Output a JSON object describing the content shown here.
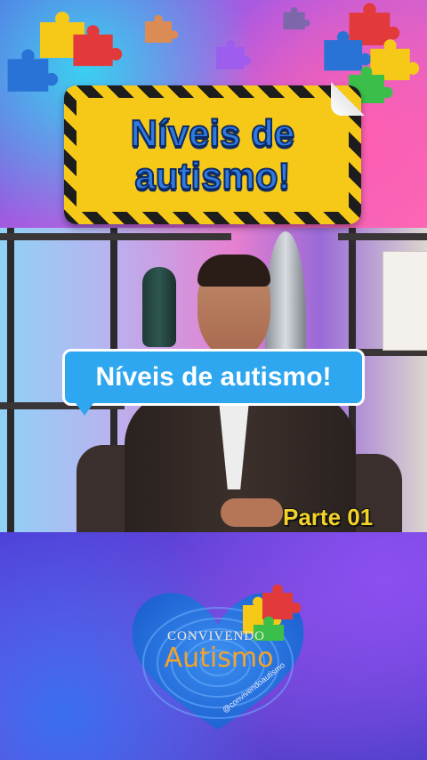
{
  "banner": {
    "title": "Níveis de\nautismo!"
  },
  "caption": {
    "text": "Níveis de autismo!"
  },
  "part_label": "Parte 01",
  "logo": {
    "brand_top": "CONVIVENDO",
    "brand_main": "Autismo",
    "handle": "@convivendoautismo"
  },
  "colors": {
    "banner_yellow": "#f6c919",
    "title_blue": "#2f7be0",
    "caption_blue": "#2ea6f0",
    "part_yellow": "#f4d22a",
    "brand_orange": "#f2a32c"
  }
}
